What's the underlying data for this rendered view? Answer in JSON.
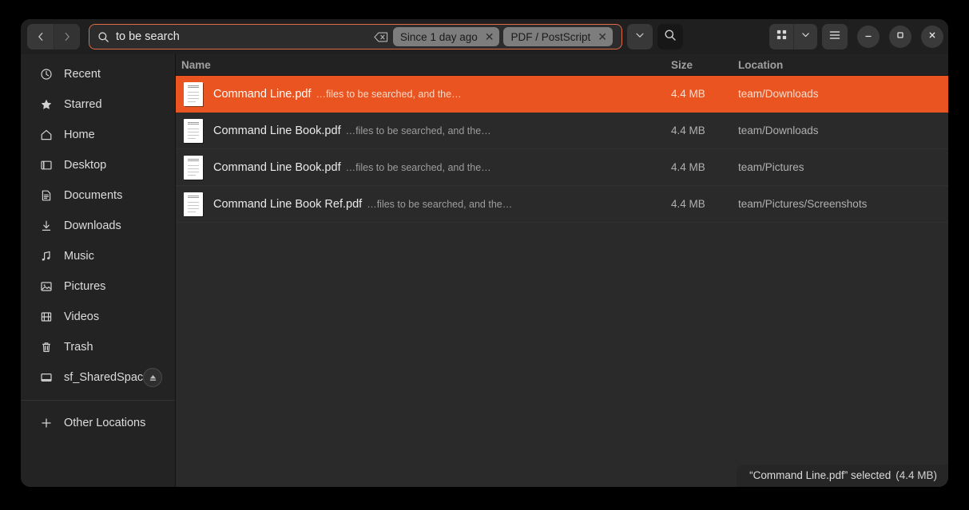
{
  "window": {
    "accent_color": "#e95420",
    "background": "#2a2a2a"
  },
  "header": {
    "back_icon": "chevron-left-icon",
    "forward_icon": "chevron-right-icon",
    "search": {
      "icon": "search-icon",
      "value": "to be search",
      "placeholder": "Search",
      "clear_icon": "clear-backspace-icon"
    },
    "filters": [
      {
        "label": "Since 1 day ago",
        "remove_icon": "close-icon"
      },
      {
        "label": "PDF / PostScript",
        "remove_icon": "close-icon"
      }
    ],
    "dropdown_icon": "chevron-down-icon",
    "search_button_icon": "search-icon",
    "view_grid_icon": "grid-view-icon",
    "view_dropdown_icon": "chevron-down-icon",
    "menu_icon": "hamburger-menu-icon",
    "minimize_icon": "minimize-icon",
    "maximize_icon": "maximize-icon",
    "close_icon": "close-icon"
  },
  "sidebar": {
    "items": [
      {
        "label": "Recent",
        "icon": "clock-icon"
      },
      {
        "label": "Starred",
        "icon": "star-icon"
      },
      {
        "label": "Home",
        "icon": "home-icon"
      },
      {
        "label": "Desktop",
        "icon": "desktop-icon"
      },
      {
        "label": "Documents",
        "icon": "document-icon"
      },
      {
        "label": "Downloads",
        "icon": "download-icon"
      },
      {
        "label": "Music",
        "icon": "music-note-icon"
      },
      {
        "label": "Pictures",
        "icon": "picture-icon"
      },
      {
        "label": "Videos",
        "icon": "video-film-icon"
      },
      {
        "label": "Trash",
        "icon": "trash-icon"
      },
      {
        "label": "sf_SharedSpace",
        "icon": "drive-icon",
        "eject_icon": "eject-icon"
      }
    ],
    "other_locations": {
      "label": "Other Locations",
      "icon": "plus-icon"
    }
  },
  "file_list": {
    "columns": {
      "name": "Name",
      "size": "Size",
      "location": "Location"
    },
    "rows": [
      {
        "name": "Command Line.pdf",
        "snippet": "…files to be searched, and the…",
        "size": "4.4 MB",
        "location": "team/Downloads",
        "icon": "pdf-file-icon",
        "selected": true
      },
      {
        "name": "Command Line Book.pdf",
        "snippet": "…files to be searched, and the…",
        "size": "4.4 MB",
        "location": "team/Downloads",
        "icon": "pdf-file-icon",
        "selected": false
      },
      {
        "name": "Command Line Book.pdf",
        "snippet": "…files to be searched, and the…",
        "size": "4.4 MB",
        "location": "team/Pictures",
        "icon": "pdf-file-icon",
        "selected": false
      },
      {
        "name": "Command Line Book Ref.pdf",
        "snippet": "…files to be searched, and the…",
        "size": "4.4 MB",
        "location": "team/Pictures/Screenshots",
        "icon": "pdf-file-icon",
        "selected": false
      }
    ]
  },
  "status_bar": {
    "text": "“Command Line.pdf” selected",
    "size": "(4.4 MB)"
  }
}
